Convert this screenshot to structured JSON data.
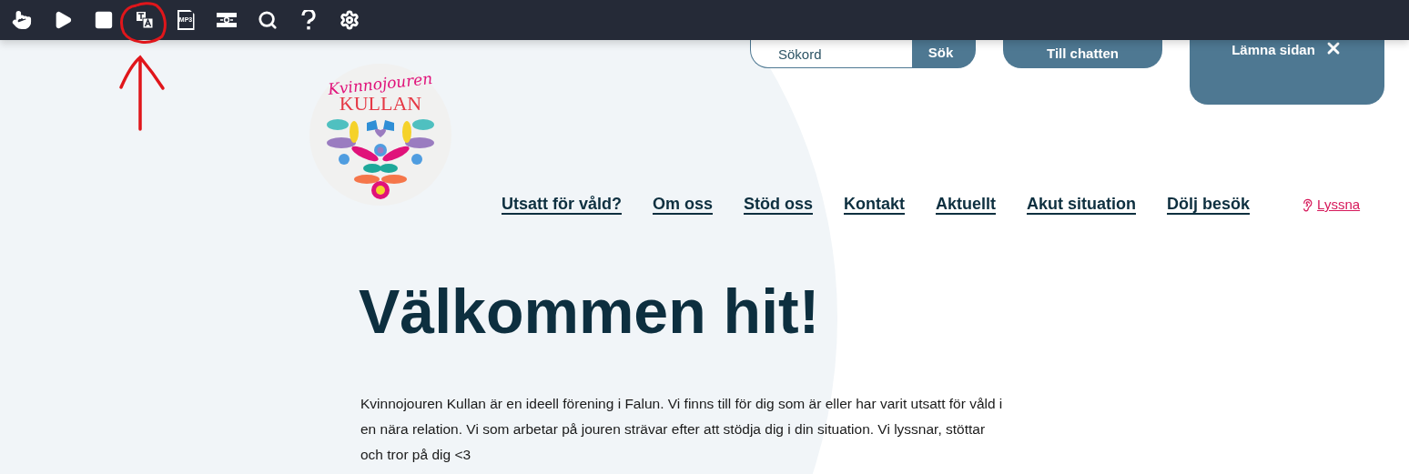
{
  "toolbar": {
    "tools": [
      {
        "kind": "pointer"
      },
      {
        "kind": "play"
      },
      {
        "kind": "stop"
      },
      {
        "kind": "translate"
      },
      {
        "kind": "mp3",
        "label": "MP3"
      },
      {
        "kind": "reader"
      },
      {
        "kind": "zoom"
      },
      {
        "kind": "help"
      },
      {
        "kind": "settings"
      }
    ]
  },
  "header": {
    "search": {
      "placeholder": "Sökord",
      "button": "Sök"
    },
    "chat_button": "Till chatten",
    "leave_button": "Lämna sidan"
  },
  "logo": {
    "script": "Kvinnojouren",
    "name": "KULLAN"
  },
  "nav": {
    "items": [
      "Utsatt för våld?",
      "Om oss",
      "Stöd oss",
      "Kontakt",
      "Aktuellt",
      "Akut situation",
      "Dölj besök"
    ],
    "listen": "Lyssna"
  },
  "main": {
    "heading": "Välkommen hit!",
    "intro": "Kvinnojouren Kullan är en ideell förening i Falun. Vi finns till för dig som är eller har varit utsatt för våld i en nära relation. Vi som arbetar på jouren strävar efter att stödja dig i din situation. Vi lyssnar, stöttar och tror på dig <3"
  }
}
